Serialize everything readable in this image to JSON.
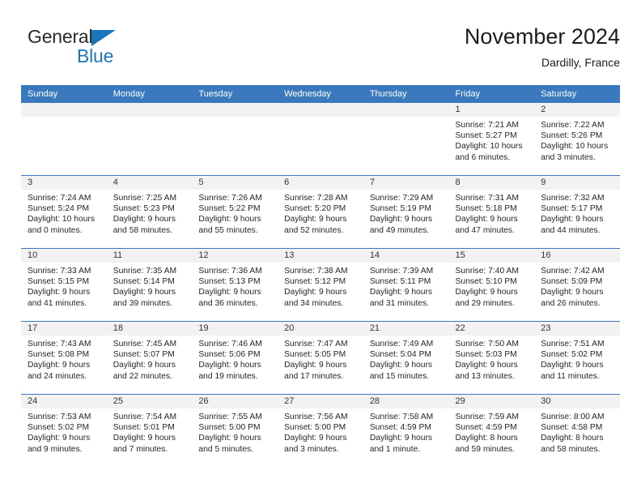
{
  "brand": {
    "word1": "General",
    "word2": "Blue",
    "accent_color": "#1b75bb"
  },
  "header": {
    "title": "November 2024",
    "subtitle": "Dardilly, France"
  },
  "theme": {
    "header_blue": "#3a79bd",
    "daynum_band": "#f2f2f2",
    "cell_bg": "#ffffff",
    "text": "#262626"
  },
  "weekday_headers": [
    "Sunday",
    "Monday",
    "Tuesday",
    "Wednesday",
    "Thursday",
    "Friday",
    "Saturday"
  ],
  "weeks": [
    [
      {
        "day": "",
        "lines": []
      },
      {
        "day": "",
        "lines": []
      },
      {
        "day": "",
        "lines": []
      },
      {
        "day": "",
        "lines": []
      },
      {
        "day": "",
        "lines": []
      },
      {
        "day": "1",
        "lines": [
          "Sunrise: 7:21 AM",
          "Sunset: 5:27 PM",
          "Daylight: 10 hours",
          "and 6 minutes."
        ]
      },
      {
        "day": "2",
        "lines": [
          "Sunrise: 7:22 AM",
          "Sunset: 5:26 PM",
          "Daylight: 10 hours",
          "and 3 minutes."
        ]
      }
    ],
    [
      {
        "day": "3",
        "lines": [
          "Sunrise: 7:24 AM",
          "Sunset: 5:24 PM",
          "Daylight: 10 hours",
          "and 0 minutes."
        ]
      },
      {
        "day": "4",
        "lines": [
          "Sunrise: 7:25 AM",
          "Sunset: 5:23 PM",
          "Daylight: 9 hours",
          "and 58 minutes."
        ]
      },
      {
        "day": "5",
        "lines": [
          "Sunrise: 7:26 AM",
          "Sunset: 5:22 PM",
          "Daylight: 9 hours",
          "and 55 minutes."
        ]
      },
      {
        "day": "6",
        "lines": [
          "Sunrise: 7:28 AM",
          "Sunset: 5:20 PM",
          "Daylight: 9 hours",
          "and 52 minutes."
        ]
      },
      {
        "day": "7",
        "lines": [
          "Sunrise: 7:29 AM",
          "Sunset: 5:19 PM",
          "Daylight: 9 hours",
          "and 49 minutes."
        ]
      },
      {
        "day": "8",
        "lines": [
          "Sunrise: 7:31 AM",
          "Sunset: 5:18 PM",
          "Daylight: 9 hours",
          "and 47 minutes."
        ]
      },
      {
        "day": "9",
        "lines": [
          "Sunrise: 7:32 AM",
          "Sunset: 5:17 PM",
          "Daylight: 9 hours",
          "and 44 minutes."
        ]
      }
    ],
    [
      {
        "day": "10",
        "lines": [
          "Sunrise: 7:33 AM",
          "Sunset: 5:15 PM",
          "Daylight: 9 hours",
          "and 41 minutes."
        ]
      },
      {
        "day": "11",
        "lines": [
          "Sunrise: 7:35 AM",
          "Sunset: 5:14 PM",
          "Daylight: 9 hours",
          "and 39 minutes."
        ]
      },
      {
        "day": "12",
        "lines": [
          "Sunrise: 7:36 AM",
          "Sunset: 5:13 PM",
          "Daylight: 9 hours",
          "and 36 minutes."
        ]
      },
      {
        "day": "13",
        "lines": [
          "Sunrise: 7:38 AM",
          "Sunset: 5:12 PM",
          "Daylight: 9 hours",
          "and 34 minutes."
        ]
      },
      {
        "day": "14",
        "lines": [
          "Sunrise: 7:39 AM",
          "Sunset: 5:11 PM",
          "Daylight: 9 hours",
          "and 31 minutes."
        ]
      },
      {
        "day": "15",
        "lines": [
          "Sunrise: 7:40 AM",
          "Sunset: 5:10 PM",
          "Daylight: 9 hours",
          "and 29 minutes."
        ]
      },
      {
        "day": "16",
        "lines": [
          "Sunrise: 7:42 AM",
          "Sunset: 5:09 PM",
          "Daylight: 9 hours",
          "and 26 minutes."
        ]
      }
    ],
    [
      {
        "day": "17",
        "lines": [
          "Sunrise: 7:43 AM",
          "Sunset: 5:08 PM",
          "Daylight: 9 hours",
          "and 24 minutes."
        ]
      },
      {
        "day": "18",
        "lines": [
          "Sunrise: 7:45 AM",
          "Sunset: 5:07 PM",
          "Daylight: 9 hours",
          "and 22 minutes."
        ]
      },
      {
        "day": "19",
        "lines": [
          "Sunrise: 7:46 AM",
          "Sunset: 5:06 PM",
          "Daylight: 9 hours",
          "and 19 minutes."
        ]
      },
      {
        "day": "20",
        "lines": [
          "Sunrise: 7:47 AM",
          "Sunset: 5:05 PM",
          "Daylight: 9 hours",
          "and 17 minutes."
        ]
      },
      {
        "day": "21",
        "lines": [
          "Sunrise: 7:49 AM",
          "Sunset: 5:04 PM",
          "Daylight: 9 hours",
          "and 15 minutes."
        ]
      },
      {
        "day": "22",
        "lines": [
          "Sunrise: 7:50 AM",
          "Sunset: 5:03 PM",
          "Daylight: 9 hours",
          "and 13 minutes."
        ]
      },
      {
        "day": "23",
        "lines": [
          "Sunrise: 7:51 AM",
          "Sunset: 5:02 PM",
          "Daylight: 9 hours",
          "and 11 minutes."
        ]
      }
    ],
    [
      {
        "day": "24",
        "lines": [
          "Sunrise: 7:53 AM",
          "Sunset: 5:02 PM",
          "Daylight: 9 hours",
          "and 9 minutes."
        ]
      },
      {
        "day": "25",
        "lines": [
          "Sunrise: 7:54 AM",
          "Sunset: 5:01 PM",
          "Daylight: 9 hours",
          "and 7 minutes."
        ]
      },
      {
        "day": "26",
        "lines": [
          "Sunrise: 7:55 AM",
          "Sunset: 5:00 PM",
          "Daylight: 9 hours",
          "and 5 minutes."
        ]
      },
      {
        "day": "27",
        "lines": [
          "Sunrise: 7:56 AM",
          "Sunset: 5:00 PM",
          "Daylight: 9 hours",
          "and 3 minutes."
        ]
      },
      {
        "day": "28",
        "lines": [
          "Sunrise: 7:58 AM",
          "Sunset: 4:59 PM",
          "Daylight: 9 hours",
          "and 1 minute."
        ]
      },
      {
        "day": "29",
        "lines": [
          "Sunrise: 7:59 AM",
          "Sunset: 4:59 PM",
          "Daylight: 8 hours",
          "and 59 minutes."
        ]
      },
      {
        "day": "30",
        "lines": [
          "Sunrise: 8:00 AM",
          "Sunset: 4:58 PM",
          "Daylight: 8 hours",
          "and 58 minutes."
        ]
      }
    ]
  ]
}
